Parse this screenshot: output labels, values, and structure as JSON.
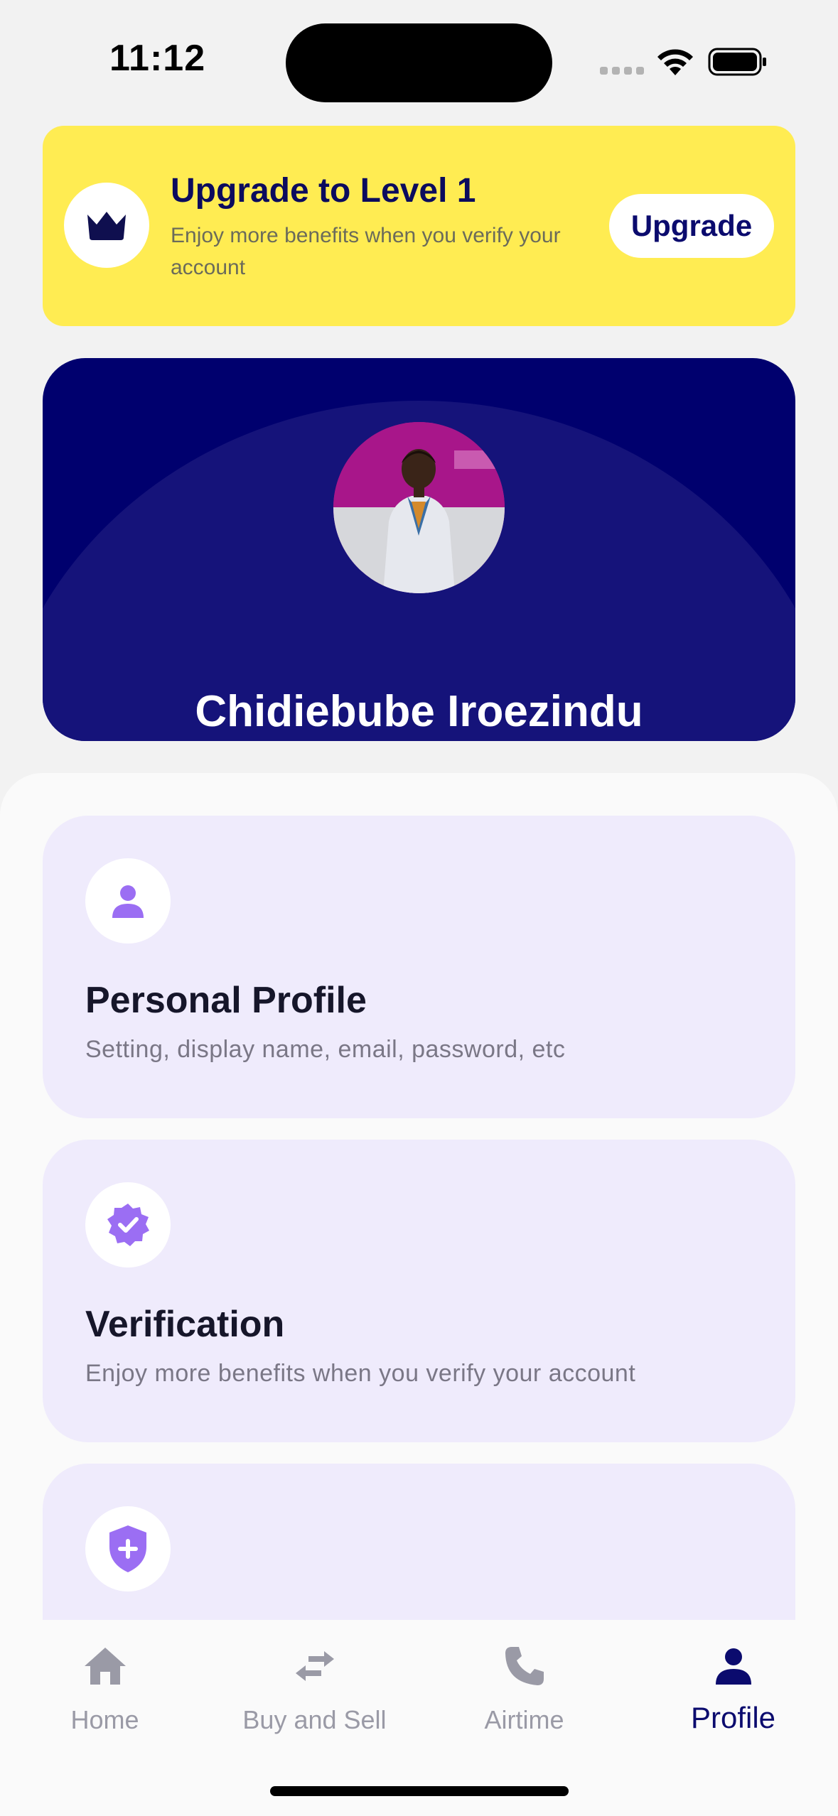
{
  "status_bar": {
    "time": "11:12",
    "icons": [
      "signal-dots-icon",
      "wifi-icon",
      "battery-icon"
    ]
  },
  "upgrade_banner": {
    "title": "Upgrade to Level 1",
    "subtitle": "Enjoy more benefits when you verify your account",
    "button_label": "Upgrade",
    "icon": "crown-icon",
    "background_color": "#ffec52"
  },
  "profile": {
    "name": "Chidiebube Iroezindu",
    "avatar": "profile-photo",
    "hero_color": "#00006e"
  },
  "menu": {
    "items": [
      {
        "title": "Personal Profile",
        "description": "Setting, display name, email, password, etc",
        "icon": "person-icon"
      },
      {
        "title": "Verification",
        "description": "Enjoy more benefits when you verify your account",
        "icon": "verified-badge-icon"
      },
      {
        "title": "",
        "description": "",
        "icon": "shield-plus-icon"
      }
    ],
    "card_color": "#efebfc",
    "icon_color": "#9b6ef3"
  },
  "tab_bar": {
    "tabs": [
      {
        "label": "Home",
        "icon": "home-icon",
        "active": false
      },
      {
        "label": "Buy and Sell",
        "icon": "swap-arrows-icon",
        "active": false
      },
      {
        "label": "Airtime",
        "icon": "phone-icon",
        "active": false
      },
      {
        "label": "Profile",
        "icon": "person-icon",
        "active": true
      }
    ],
    "active_color": "#0b0b6e",
    "inactive_color": "#9a9aa6"
  }
}
